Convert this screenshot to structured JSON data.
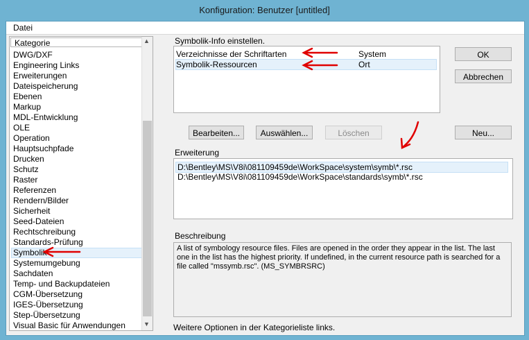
{
  "window": {
    "title": "Konfiguration: Benutzer [untitled]"
  },
  "menu": {
    "file": "Datei"
  },
  "categories": {
    "header": "Kategorie",
    "items": [
      "DWG/DXF",
      "Engineering Links",
      "Erweiterungen",
      "Dateispeicherung",
      "Ebenen",
      "Markup",
      "MDL-Entwicklung",
      "OLE",
      "Operation",
      "Hauptsuchpfade",
      "Drucken",
      "Schutz",
      "Raster",
      "Referenzen",
      "Rendern/Bilder",
      "Sicherheit",
      "Seed-Dateien",
      "Rechtschreibung",
      "Standards-Prüfung",
      "Symbolik",
      "Systemumgebung",
      "Sachdaten",
      "Temp- und Backupdateien",
      "CGM-Übersetzung",
      "IGES-Übersetzung",
      "Step-Übersetzung",
      "Visual Basic für Anwendungen"
    ],
    "selected": "Symbolik"
  },
  "info": {
    "label": "Symbolik-Info einstellen.",
    "rows": [
      {
        "name": "Verzeichnisse der Schriftarten",
        "value": "System"
      },
      {
        "name": "Symbolik-Ressourcen",
        "value": "Ort"
      }
    ]
  },
  "buttons": {
    "ok": "OK",
    "cancel": "Abbrechen",
    "edit": "Bearbeiten...",
    "select": "Auswählen...",
    "delete": "Löschen",
    "new": "Neu..."
  },
  "extension": {
    "label": "Erweiterung",
    "rows": [
      "D:\\Bentley\\MS\\V8i\\081109459de\\WorkSpace\\system\\symb\\*.rsc",
      "D:\\Bentley\\MS\\V8i\\081109459de\\WorkSpace\\standards\\symb\\*.rsc"
    ]
  },
  "description": {
    "label": "Beschreibung",
    "text": "A list of symbology resource files. Files are opened in the order they appear in the list. The last one in the list has the highest priority. If undefined, in the current resource path is searched for a file called \"mssymb.rsc\". (MS_SYMBRSRC)"
  },
  "footer": "Weitere Optionen in der Kategorieliste links.",
  "colors": {
    "annotation": "#e00000",
    "selection": "#e5f1fb",
    "titlebar": "#6fb3d2"
  }
}
